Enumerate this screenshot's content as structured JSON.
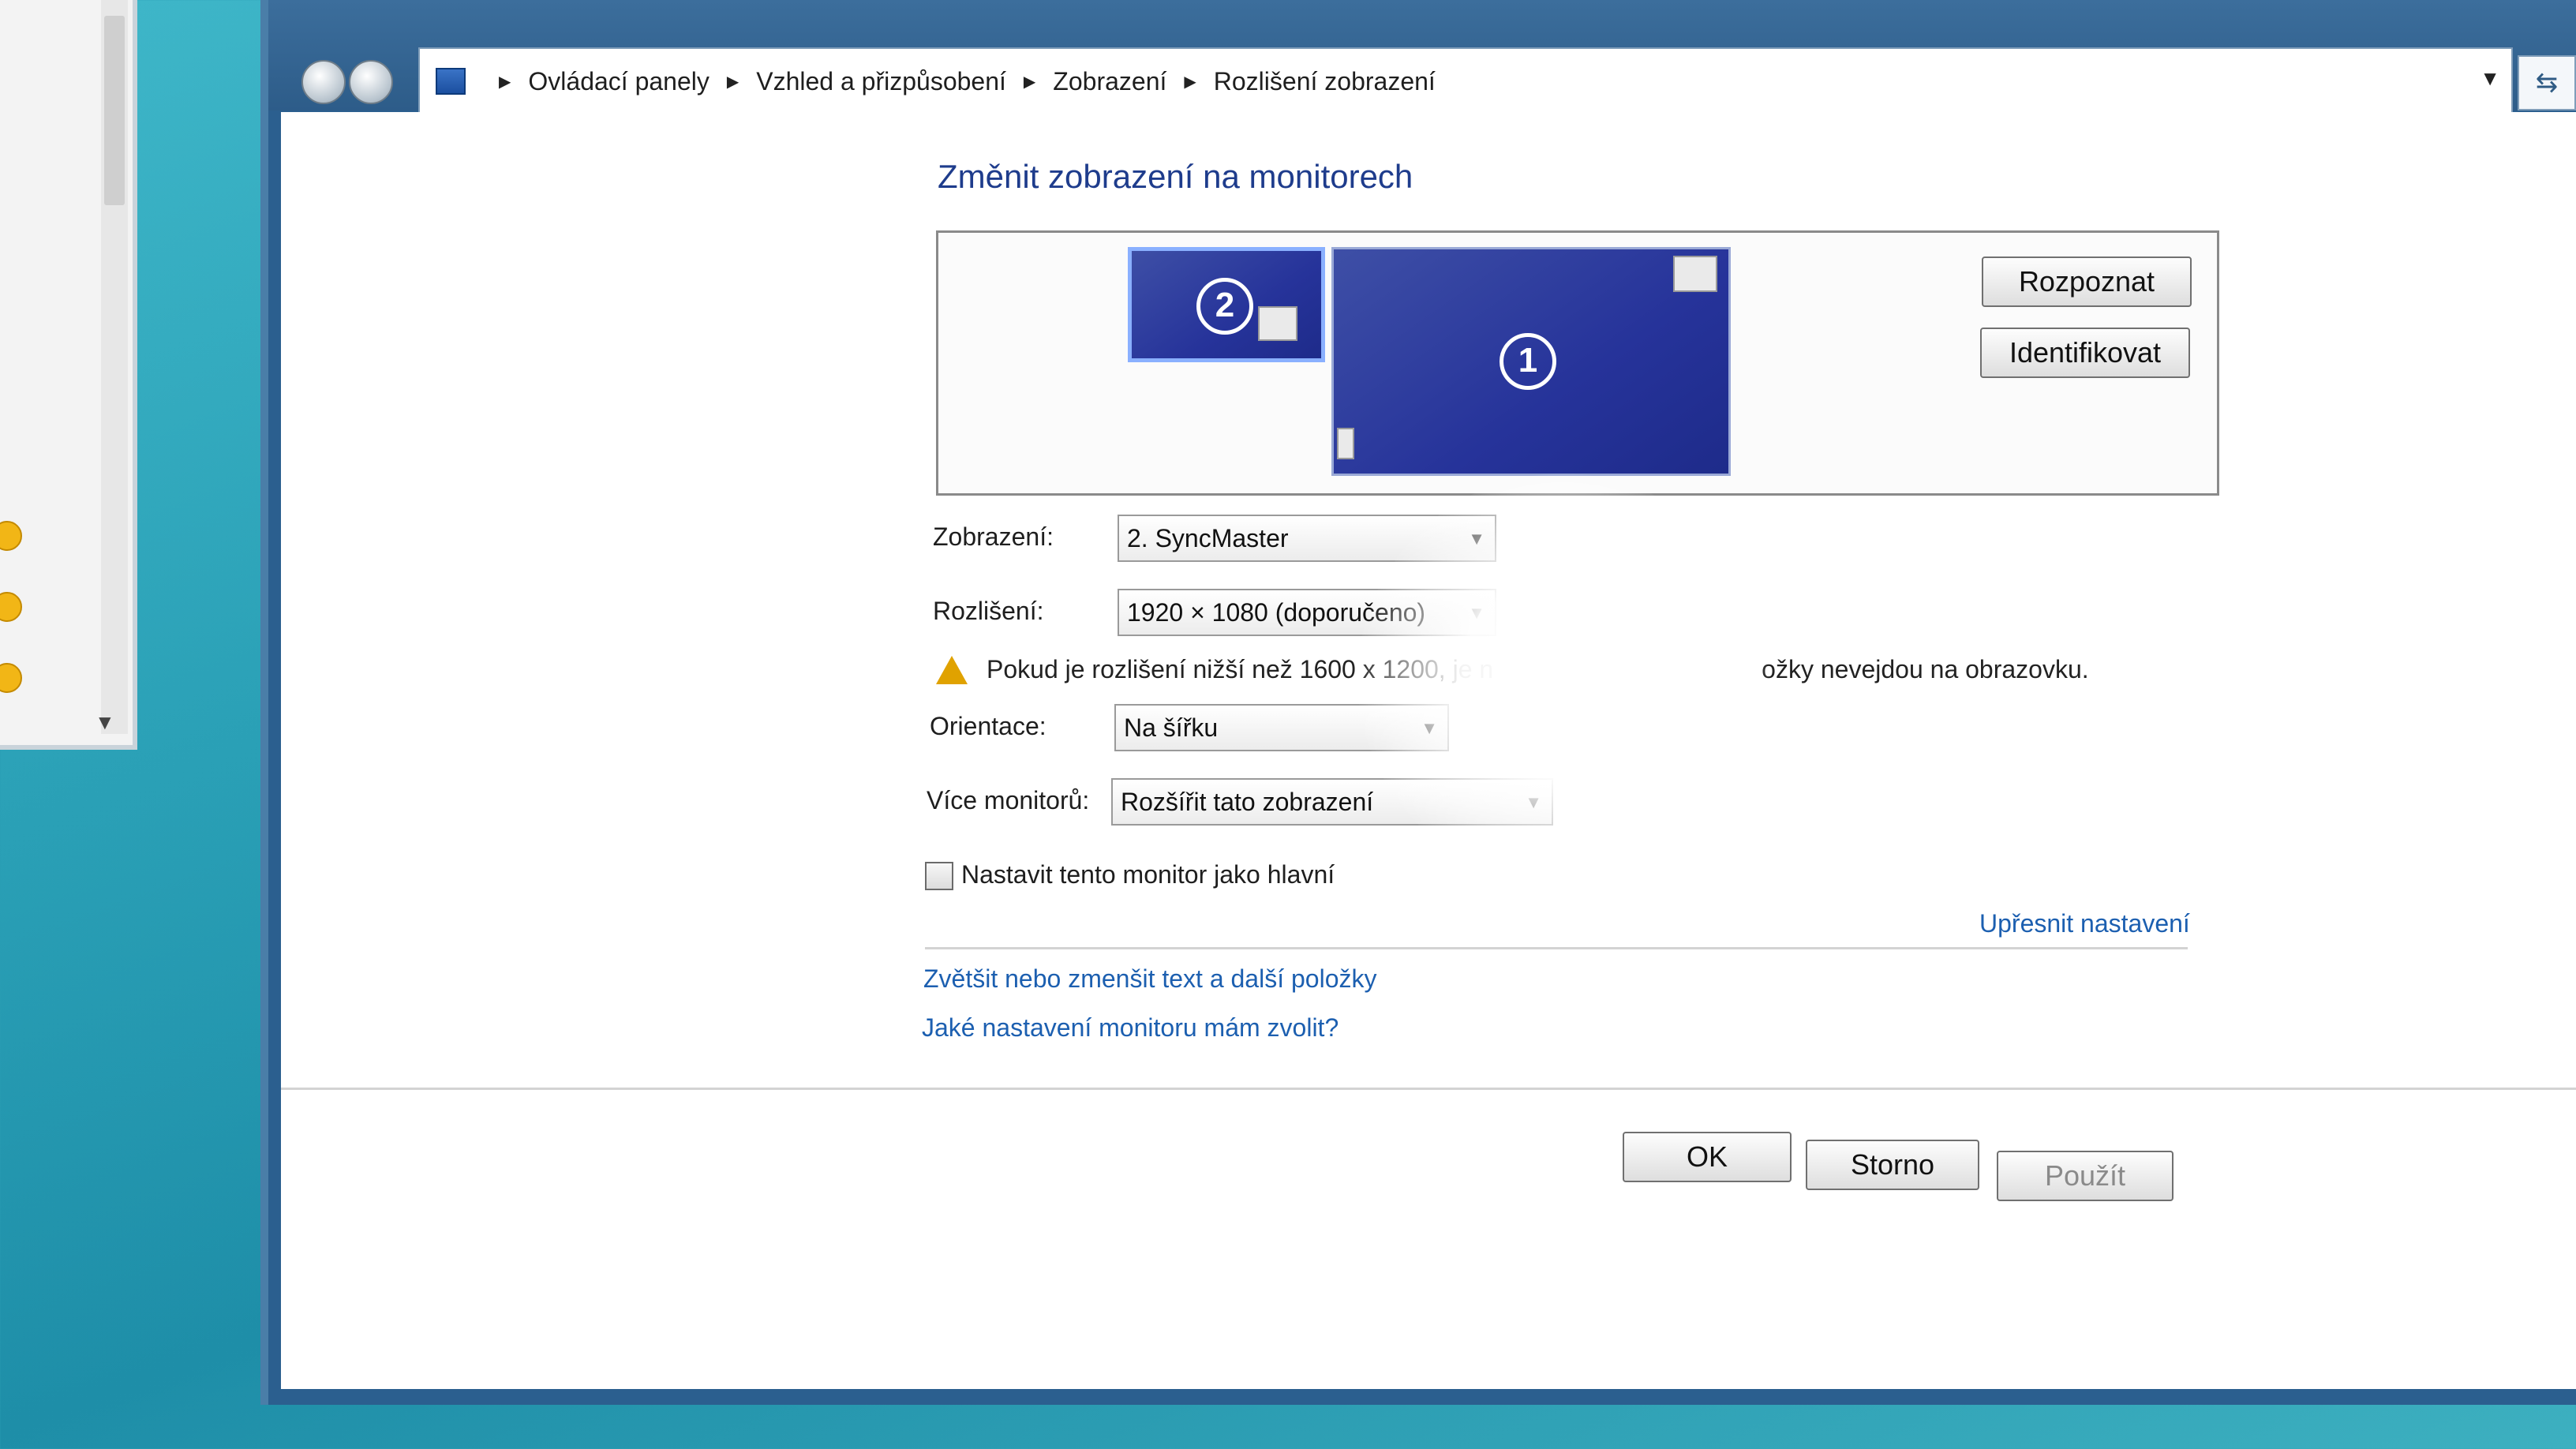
{
  "breadcrumb": {
    "items": [
      "Ovládací panely",
      "Vzhled a přizpůsobení",
      "Zobrazení",
      "Rozlišení zobrazení"
    ]
  },
  "page": {
    "heading": "Změnit zobrazení na monitorech"
  },
  "monitors": {
    "secondary_number": "2",
    "primary_number": "1",
    "detect_label": "Rozpoznat",
    "identify_label": "Identifikovat"
  },
  "settings": {
    "display_label": "Zobrazení:",
    "display_value": "2. SyncMaster",
    "resolution_label": "Rozlišení:",
    "resolution_value": "1920 × 1080 (doporučeno)",
    "warning_text_start": "Pokud je rozlišení nižší než 1600 x 1200, je n",
    "warning_text_end": "ožky nevejdou na obrazovku.",
    "orientation_label": "Orientace:",
    "orientation_value": "Na šířku",
    "multi_label": "Více monitorů:",
    "multi_value": "Rozšířit tato zobrazení",
    "main_checkbox_label": "Nastavit tento monitor jako hlavní",
    "main_checkbox_checked": false
  },
  "links": {
    "advanced": "Upřesnit nastavení",
    "text_size": "Zvětšit nebo zmenšit text a další položky",
    "which_settings": "Jaké nastavení monitoru mám zvolit?"
  },
  "buttons": {
    "ok": "OK",
    "cancel": "Storno",
    "apply": "Použít"
  },
  "colors": {
    "link": "#1c5fb0",
    "heading": "#1e3c8c",
    "monitor": "#26339a",
    "warning": "#e0a200"
  }
}
